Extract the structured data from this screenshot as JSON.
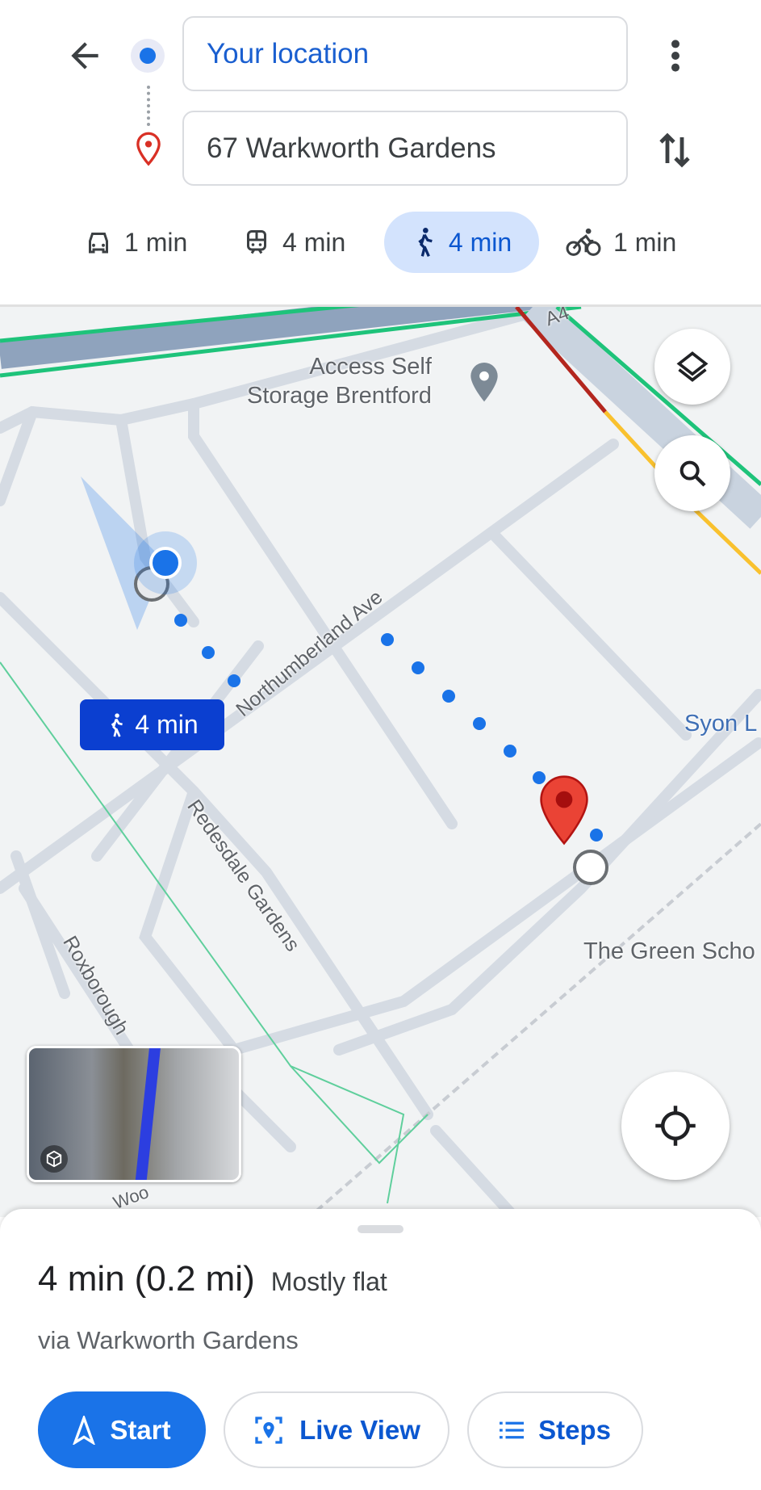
{
  "header": {
    "origin_value": "Your location",
    "destination_value": "67 Warkworth Gardens",
    "icons": {
      "back": "arrow-left-icon",
      "more": "more-vert-icon",
      "swap": "swap-vert-icon",
      "origin": "blue-dot-icon",
      "destination": "location-pin-icon"
    }
  },
  "modes": [
    {
      "icon": "car-icon",
      "label": "1 min",
      "selected": false
    },
    {
      "icon": "train-icon",
      "label": "4 min",
      "selected": false
    },
    {
      "icon": "walk-icon",
      "label": "4 min",
      "selected": true
    },
    {
      "icon": "bike-icon",
      "label": "1 min",
      "selected": false
    }
  ],
  "map": {
    "poi": "Access Self\nStorage Brentford",
    "road_a4": "A4",
    "streets": {
      "northumberland": "Northumberland Ave",
      "redesdale": "Redesdale Gardens",
      "roxborough": "Roxborough",
      "syon": "Syon L",
      "green_school": "The Green Scho",
      "partial": "Woo"
    },
    "route_label": "4 min",
    "colors": {
      "route": "#1a73e8",
      "label_bg": "#0b3fd0",
      "pin": "#ea4335"
    }
  },
  "sheet": {
    "duration": "4 min",
    "distance": "(0.2 mi)",
    "terrain": "Mostly flat",
    "via": "via Warkworth Gardens",
    "start_label": "Start",
    "live_view_label": "Live View",
    "steps_label": "Steps"
  }
}
